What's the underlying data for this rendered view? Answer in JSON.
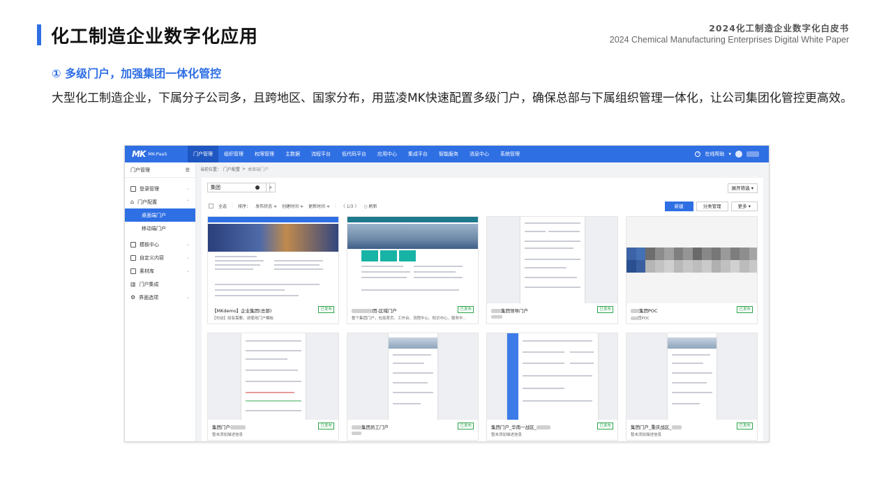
{
  "header": {
    "title": "化工制造企业数字化应用",
    "doc_title_cn": "2024化工制造企业数字化白皮书",
    "doc_title_en": "2024 Chemical Manufacturing Enterprises Digital White Paper"
  },
  "section": {
    "heading": "① 多级门户，加强集团一体化管控",
    "paragraph": "大型化工制造企业，下属分子公司多，且跨地区、国家分布，用蓝凌MK快速配置多级门户，确保总部与下属组织管理一体化，让公司集团化管控更高效。"
  },
  "app": {
    "logo_text": "MK-PaaS",
    "nav": [
      "门户管理",
      "组织管理",
      "权限管理",
      "主数据",
      "流程平台",
      "低代码平台",
      "应用中心",
      "集成平台",
      "智能服务",
      "消息中心",
      "系统管理"
    ],
    "help": "在线帮助",
    "sidebar": {
      "title": "门户管理",
      "items": [
        {
          "label": "登录管理",
          "icon": "monitor-icon"
        },
        {
          "label": "门户配置",
          "icon": "home-icon"
        },
        {
          "label": "模板中心",
          "icon": "template-icon"
        },
        {
          "label": "自定义内容",
          "icon": "custom-icon"
        },
        {
          "label": "素材库",
          "icon": "folder-icon"
        },
        {
          "label": "门户集成",
          "icon": "chart-icon"
        },
        {
          "label": "界面选项",
          "icon": "gear-icon"
        }
      ],
      "sub_items": [
        "桌面端门户",
        "移动端门户"
      ]
    },
    "breadcrumb": [
      "当前位置：",
      "门户配置",
      ">",
      "桌面端门户"
    ],
    "search_value": "集团",
    "expand_filter": "展开筛选 ▾",
    "toolbar": {
      "select_all": "全选",
      "sort": "排序：",
      "publish_status": "发布状态 ≑",
      "create_time": "创建时间 ≑",
      "update_time": "更新时间 ≑",
      "pager": "〈 1/3 〉",
      "refresh": "○ 刷新"
    },
    "buttons": {
      "new": "新建",
      "category": "分类管理",
      "more": "更多 ▾"
    },
    "status_label": "已发布",
    "cards": [
      {
        "name": "【MKdemo】企业集团(总部)",
        "desc": "【勿动】如有需要，请使用门户模板"
      },
      {
        "name": "团-区域门户",
        "desc": "整个集团门户，包括首页、工作台、流程中心、知识中心、服务中..."
      },
      {
        "name": "集团领导门户",
        "desc": ""
      },
      {
        "name": "集团POC",
        "desc": "团POC"
      },
      {
        "name": "集团门户",
        "desc": "暂未添加描述信息"
      },
      {
        "name": "集团员工门户",
        "desc": ""
      },
      {
        "name": "集团门户_华南一战区_",
        "desc": "暂未添加描述信息"
      },
      {
        "name": "集团门户_重庆战区_",
        "desc": "暂未添加描述信息"
      }
    ]
  }
}
